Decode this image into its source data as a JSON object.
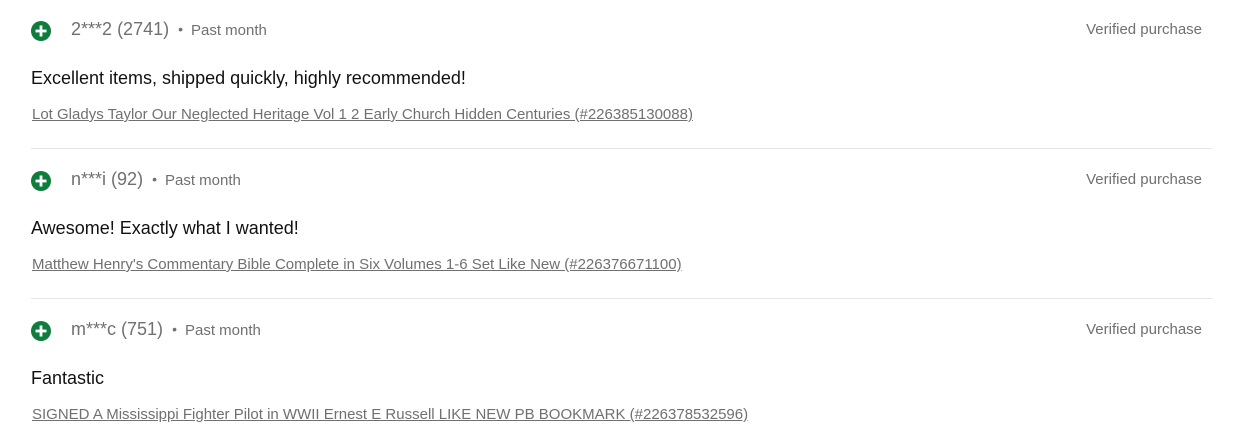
{
  "colors": {
    "positive_icon": "#0e7c3a",
    "muted_text": "#707070",
    "body_text": "#111111",
    "divider": "#e5e5e5"
  },
  "reviews": [
    {
      "rating_icon": "plus-circle-icon",
      "user": "2***2",
      "score": "(2741)",
      "separator": "•",
      "period": "Past month",
      "badge": "Verified purchase",
      "comment": "Excellent items, shipped quickly, highly recommended!",
      "item": "Lot Gladys Taylor Our Neglected Heritage Vol 1 2 Early Church Hidden Centuries (#226385130088)"
    },
    {
      "rating_icon": "plus-circle-icon",
      "user": "n***i",
      "score": "(92)",
      "separator": "•",
      "period": "Past month",
      "badge": "Verified purchase",
      "comment": "Awesome! Exactly what I wanted!",
      "item": "Matthew Henry's Commentary Bible Complete in Six Volumes 1-6 Set Like New (#226376671100)"
    },
    {
      "rating_icon": "plus-circle-icon",
      "user": "m***c",
      "score": "(751)",
      "separator": "•",
      "period": "Past month",
      "badge": "Verified purchase",
      "comment": "Fantastic",
      "item": "SIGNED A Mississippi Fighter Pilot in WWII Ernest E Russell LIKE NEW PB BOOKMARK (#226378532596)"
    }
  ]
}
